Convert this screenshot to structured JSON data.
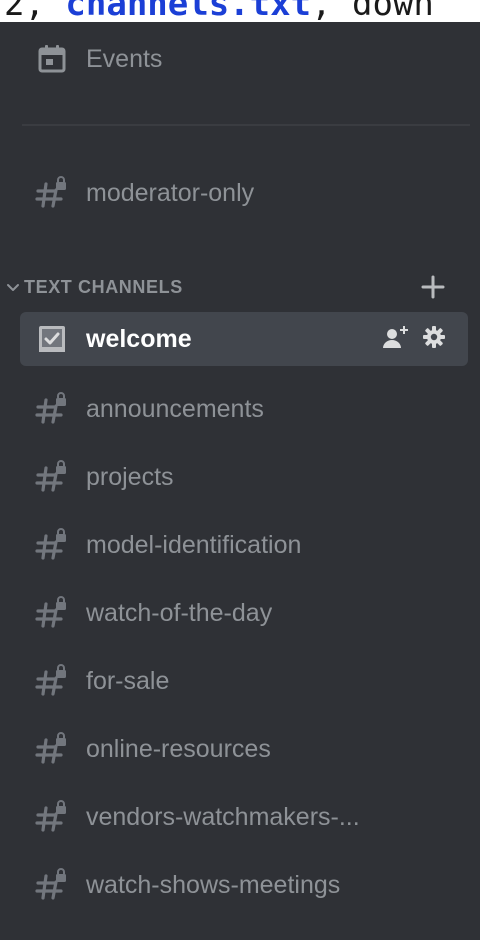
{
  "top_strip": {
    "prefix": "2, ",
    "link": "channels.txt",
    "suffix": ", down"
  },
  "events": {
    "label": "Events",
    "icon": "calendar-icon"
  },
  "ungrouped_channels": [
    {
      "label": "moderator-only",
      "icon": "locked-hash-icon"
    }
  ],
  "category": {
    "label": "TEXT CHANNELS",
    "collapse_icon": "chevron-down-icon",
    "add_icon": "plus-icon"
  },
  "channels": [
    {
      "label": "welcome",
      "icon": "rules-channel-icon",
      "selected": true
    },
    {
      "label": "announcements",
      "icon": "locked-hash-icon"
    },
    {
      "label": "projects",
      "icon": "locked-hash-icon"
    },
    {
      "label": "model-identification",
      "icon": "locked-hash-icon"
    },
    {
      "label": "watch-of-the-day",
      "icon": "locked-hash-icon"
    },
    {
      "label": "for-sale",
      "icon": "locked-hash-icon"
    },
    {
      "label": "online-resources",
      "icon": "locked-hash-icon"
    },
    {
      "label": "vendors-watchmakers-...",
      "icon": "locked-hash-icon"
    },
    {
      "label": "watch-shows-meetings",
      "icon": "locked-hash-icon"
    }
  ],
  "selected_actions": [
    {
      "icon": "create-invite-icon"
    },
    {
      "icon": "gear-icon"
    }
  ],
  "colors": {
    "background": "#2f3136",
    "selected_background": "#42464d",
    "muted_text": "#8e9297",
    "selected_text": "#ffffff",
    "icon_gray": "#72767d",
    "icon_light": "#b9bbbe"
  }
}
